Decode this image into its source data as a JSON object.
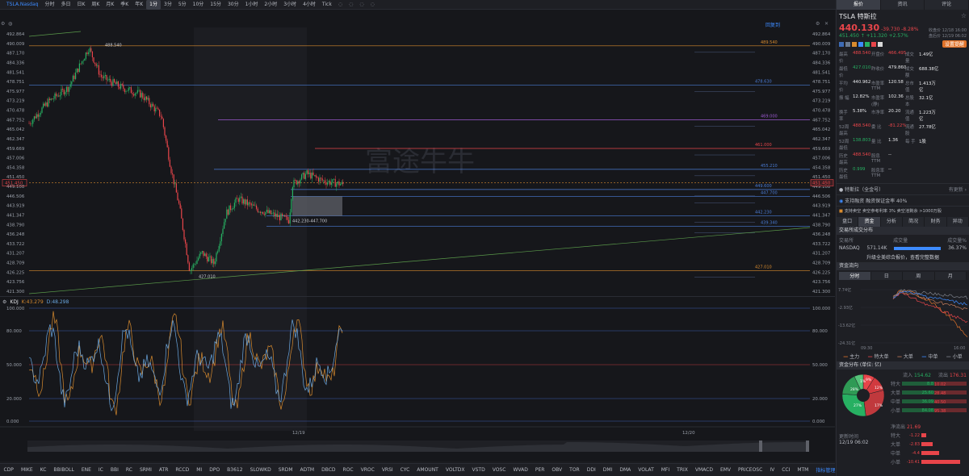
{
  "toolbar": {
    "ticker": "TSLA.Nasdaq",
    "intervals": [
      "分时",
      "多日",
      "日K",
      "周K",
      "月K",
      "季K",
      "年K",
      "1分",
      "3分",
      "5分",
      "10分",
      "15分",
      "30分",
      "1小时",
      "2小时",
      "3小时",
      "4小时",
      "Tick"
    ],
    "active_interval": "1分",
    "right": [
      "显示",
      "Δ",
      "V5",
      "P10"
    ]
  },
  "chart": {
    "rescale_label": "回复到",
    "price_axis": [
      "492.864",
      "490.009",
      "487.170",
      "484.336",
      "481.541",
      "478.751",
      "475.977",
      "473.219",
      "470.478",
      "467.752",
      "465.042",
      "462.347",
      "459.669",
      "457.006",
      "454.358",
      "451.450",
      "449.108",
      "446.506",
      "443.919",
      "441.347",
      "438.790",
      "436.248",
      "433.722",
      "431.207",
      "428.709",
      "426.225",
      "423.756",
      "421.300"
    ],
    "last_price_tag": "451.450",
    "levels": [
      {
        "price": 489.54,
        "label": "489.540",
        "color": "#d88b2e"
      },
      {
        "price": 478.63,
        "label": "478.630",
        "color": "#4a7cd6"
      },
      {
        "price": 469.0,
        "label": "469.000",
        "color": "#9b59d0"
      },
      {
        "price": 461.0,
        "label": "461.000",
        "color": "#e8454a"
      },
      {
        "price": 455.21,
        "label": "455.210",
        "color": "#4a7cd6"
      },
      {
        "price": 449.6,
        "label": "449.600",
        "color": "#4a7cd6"
      },
      {
        "price": 447.7,
        "label": "447.700",
        "color": "#4a7cd6"
      },
      {
        "price": 442.23,
        "label": "442.230",
        "color": "#4a7cd6"
      },
      {
        "price": 439.34,
        "label": "439.340",
        "color": "#4a7cd6"
      },
      {
        "price": 427.01,
        "label": "427.010",
        "color": "#d88b2e"
      }
    ],
    "high_label": "488.540",
    "low_label": "427.010",
    "gap_label": "442.230-447.700",
    "date_labels": [
      "12/19",
      "12/20"
    ],
    "watermark": "富途牛牛"
  },
  "kdj": {
    "title": "KDJ",
    "k": "K:43.279",
    "d": "D:48.298",
    "axis": [
      "100.000",
      "80.000",
      "50.000",
      "20.000",
      "0.000"
    ],
    "axis_right": [
      "100.000",
      "80.000",
      "50.000",
      "20.000",
      "0.000"
    ],
    "colors": {
      "k": "#d88b2e",
      "d": "#6aa7e0"
    }
  },
  "indicators": [
    "CDP",
    "MIKE",
    "KC",
    "BBIBOLL",
    "ENE",
    "IC",
    "BBI",
    "RC",
    "SRMI",
    "ATR",
    "RCCD",
    "MI",
    "DPO",
    "B3612",
    "SLOWKD",
    "SRDM",
    "ADTM",
    "DBCD",
    "ROC",
    "VROC",
    "VRSI",
    "CYC",
    "AMOUNT",
    "VOLTDX",
    "VSTD",
    "VOSC",
    "WVAD",
    "PER",
    "OBV",
    "TOR",
    "DDI",
    "DMI",
    "DMA",
    "VOLAT",
    "MFI",
    "TRIX",
    "VMACD",
    "EMV",
    "PRICEOSC",
    "IV",
    "CCI",
    "MTM"
  ],
  "indicator_mgmt": "指标管理",
  "indicator_time": "时间",
  "panel": {
    "tabs": [
      "报价",
      "资讯",
      "评论"
    ],
    "symbol": "TSLA",
    "name": "特斯拉",
    "price": "440.130",
    "price_change": "-39.730 -8.28%",
    "after_hours": "451.450 ↑ +11.320 +2.57%",
    "timestamps": [
      "收盘价 12/18 16:00",
      "盘后价 12/19 06:02"
    ],
    "action_btn": "设置提醒",
    "quote_rows": [
      [
        "最高价",
        "488.540",
        "开盘价",
        "466.495",
        "成交量",
        "1.49亿"
      ],
      [
        "最低价",
        "427.010",
        "昨收价",
        "479.860",
        "成交额",
        "688.38亿"
      ],
      [
        "平均价",
        "440.962",
        "市盈率TTM",
        "120.58",
        "总市值",
        "1.413万亿"
      ],
      [
        "振 幅",
        "12.82%",
        "市盈率(静)",
        "102.36",
        "总股本",
        "32.1亿"
      ],
      [
        "换手率",
        "5.38%",
        "市净率",
        "20.20",
        "流通值",
        "1.223万亿"
      ],
      [
        "52周最高",
        "488.540",
        "委 比",
        "-81.22%",
        "流通股",
        "27.78亿"
      ],
      [
        "52周最低",
        "138.803",
        "量 比",
        "1.36",
        "每 手",
        "1股"
      ],
      [
        "历史最高",
        "488.540",
        "股息TTM",
        "--",
        "",
        ""
      ],
      [
        "历史最低",
        "0.999",
        "股息率TTM",
        "--",
        "",
        ""
      ]
    ],
    "shareholder": "特斯拉（全金号）",
    "more_update": "有更新 ›",
    "margin1": "支持融资   融资保证金率 40%",
    "margin2": "支持卖空   卖空参考利率 3%  卖空池剩余 >1000万股",
    "subtabs": [
      "盘口",
      "资金",
      "分析",
      "简况",
      "财务",
      "异动"
    ],
    "active_subtab": "资金",
    "exchange_title": "交易所成交分布",
    "exchange_cols": [
      "交易所",
      "成交量",
      "成交量%"
    ],
    "exchange_row": [
      "NASDAQ",
      "571.14K",
      "36.37%"
    ],
    "exchange_more": "升级全美综合报价，查看完整数据",
    "flow_title": "资金流向",
    "flow_tabs": [
      "分时",
      "日",
      "周",
      "月"
    ],
    "flow_axis": [
      "7.74亿",
      "-2.93亿",
      "-13.62亿",
      "-24.31亿"
    ],
    "flow_time": [
      "09:30",
      "16:00"
    ],
    "flow_legend": [
      "主力",
      "特大单",
      "大单",
      "中单",
      "小单"
    ],
    "dist_title": "资金分布 (单位: 亿)",
    "in_label": "流入",
    "in_value": "154.62",
    "out_label": "流出",
    "out_value": "176.31",
    "dist_rows": [
      [
        "特大",
        "8.8",
        "10.02"
      ],
      [
        "大单",
        "25.60",
        "28.48"
      ],
      [
        "中单",
        "36.09",
        "40.50"
      ],
      [
        "小单",
        "84.08",
        "95.38"
      ]
    ],
    "pie_pcts": [
      "9%",
      "12%",
      "17%",
      "27%",
      "28%",
      "1%"
    ],
    "net_label": "净流出",
    "net_value": "21.69",
    "update_time_label": "更新时间",
    "update_time": "12/19 06:02",
    "net_rows": [
      [
        "特大",
        "-1.22"
      ],
      [
        "大单",
        "-2.83"
      ],
      [
        "中单",
        "-4.4"
      ],
      [
        "小单",
        "-10.41"
      ]
    ]
  }
}
